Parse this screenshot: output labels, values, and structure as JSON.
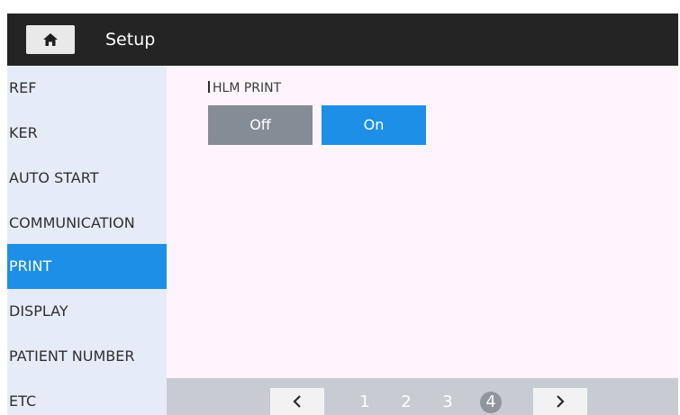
{
  "header": {
    "title": "Setup",
    "home_icon": "home-icon"
  },
  "sidebar": {
    "items": [
      {
        "label": "REF",
        "active": false
      },
      {
        "label": "KER",
        "active": false
      },
      {
        "label": "AUTO START",
        "active": false
      },
      {
        "label": "COMMUNICATION",
        "active": false
      },
      {
        "label": "PRINT",
        "active": true
      },
      {
        "label": "DISPLAY",
        "active": false
      },
      {
        "label": "PATIENT NUMBER",
        "active": false
      },
      {
        "label": "ETC",
        "active": false
      }
    ]
  },
  "main": {
    "section_label": "HLM PRINT",
    "toggle": {
      "off_label": "Off",
      "on_label": "On",
      "selected": "On"
    }
  },
  "pagination": {
    "prev_icon": "chevron-left-icon",
    "next_icon": "chevron-right-icon",
    "pages": [
      "1",
      "2",
      "3",
      "4"
    ],
    "current_page": "4"
  },
  "colors": {
    "accent": "#1e8fe6",
    "topbar": "#242424",
    "sidebar_bg": "#e6ecf7",
    "content_bg": "#fdf5fb",
    "toggle_off": "#848c95",
    "pager_bg": "#c7cbd2"
  }
}
